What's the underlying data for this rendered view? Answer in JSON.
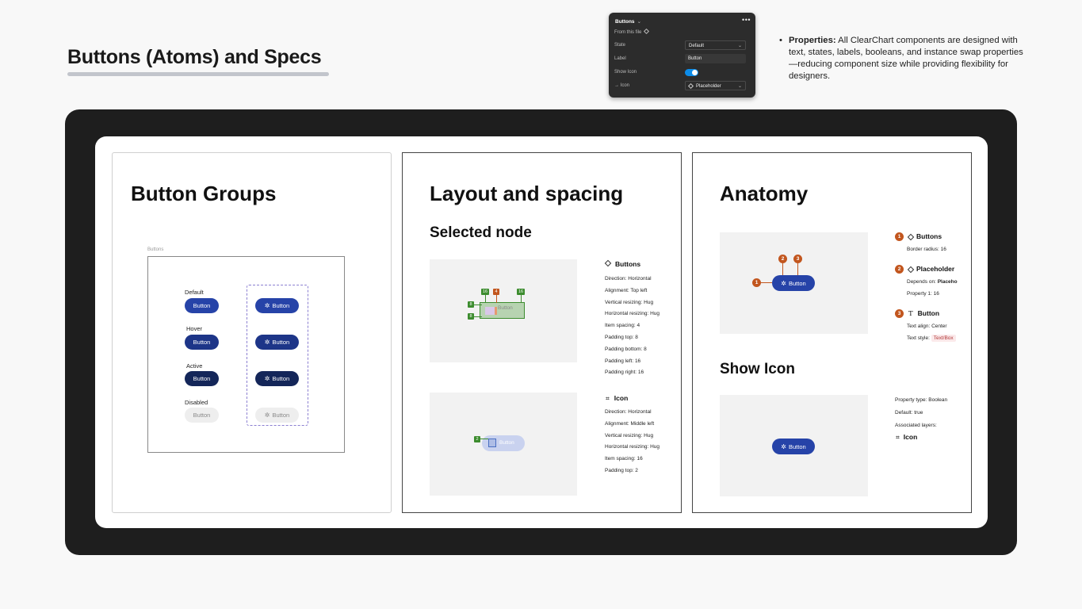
{
  "header": {
    "title": "Buttons (Atoms) and Specs"
  },
  "properties_panel": {
    "title": "Buttons",
    "title_chevron": "⌄",
    "menu": "•••",
    "from_file": "From this file",
    "rows": [
      {
        "label": "State",
        "value": "Default"
      },
      {
        "label": "Label",
        "value": "Button"
      },
      {
        "label": "Show Icon",
        "value": ""
      },
      {
        "label": "→ Icon",
        "value": "Placeholder"
      }
    ],
    "toggle_on": true,
    "accent": "#0c8ce9"
  },
  "properties_note": {
    "bullet": "•",
    "bold": "Properties:",
    "text": " All ClearChart components are designed with text, states, labels, booleans, and instance swap properties—reducing component size while providing flexibility for designers."
  },
  "button_groups": {
    "title": "Button Groups",
    "frame_label": "Buttons",
    "states": [
      "Default",
      "Hover",
      "Active",
      "Disabled"
    ],
    "button_label": "Button",
    "icon_glyph": "✲",
    "colors": {
      "default": "#2643a8",
      "hover": "#1d3588",
      "active": "#142659",
      "disabled": "#eeeeee"
    }
  },
  "layout_spacing": {
    "title": "Layout and spacing",
    "subtitle": "Selected node",
    "buttons_spec": {
      "title": "Buttons",
      "lines": [
        "Direction:  Horizontal",
        "Alignment:  Top left",
        "Vertical resizing:  Hug",
        "Horizontal resizing:  Hug",
        "Item spacing:  4",
        "Padding top:  8",
        "Padding bottom:  8",
        "Padding left:  16",
        "Padding right:  16"
      ],
      "tags": {
        "left": "16",
        "item": "4",
        "right": "16",
        "top": "8",
        "bottom": "8"
      }
    },
    "icon_spec": {
      "title": "Icon",
      "lines": [
        "Direction:  Horizontal",
        "Alignment:  Middle left",
        "Vertical resizing:  Hug",
        "Horizontal resizing:  Hug",
        "Item spacing:  16",
        "Padding top:  2"
      ],
      "tag": "2",
      "preview_label": "Button"
    },
    "preview_label": "Button"
  },
  "anatomy": {
    "title": "Anatomy",
    "button_label": "Button",
    "items": [
      {
        "num": "1",
        "title": "Buttons",
        "icon": "diamond-icon",
        "lines": [
          "Border radius:  16"
        ]
      },
      {
        "num": "2",
        "title": "Placeholder",
        "icon": "diamond-icon",
        "lines": [
          "Depends on:",
          "Property 1:  16"
        ],
        "depends_value": "Placeho"
      },
      {
        "num": "3",
        "title": "Button",
        "icon": "text-icon",
        "lines": [
          "Text align:  Center",
          "Text style:"
        ],
        "text_style": "Text/Box"
      }
    ],
    "badges": [
      "1",
      "2",
      "3"
    ]
  },
  "show_icon": {
    "title": "Show Icon",
    "button_label": "Button",
    "lines": [
      "Property type:  Boolean",
      "Default:  true",
      "Associated layers:"
    ],
    "layer": "Icon"
  }
}
